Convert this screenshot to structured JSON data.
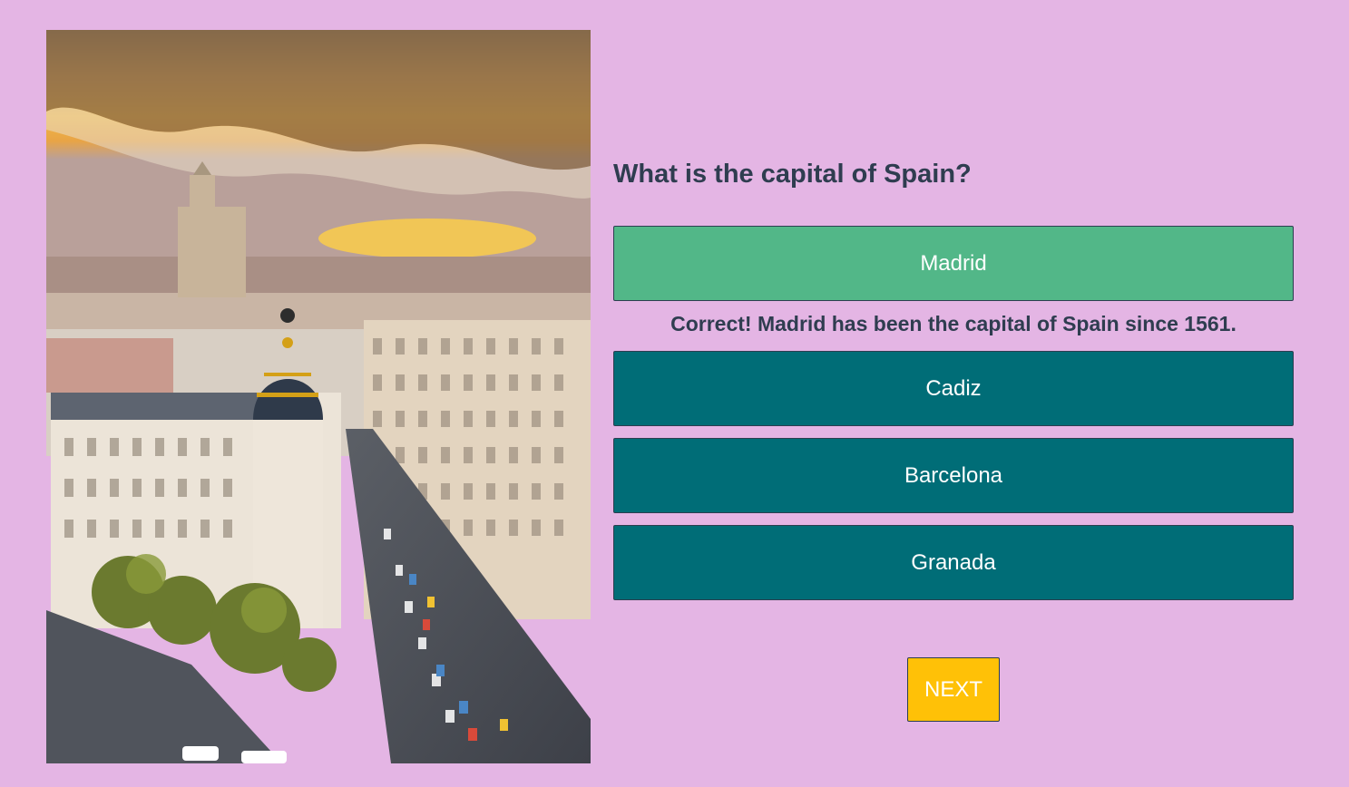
{
  "quiz": {
    "question": "What is the capital of Spain?",
    "answers": [
      {
        "label": "Madrid",
        "state": "correct"
      },
      {
        "label": "Cadiz",
        "state": "default"
      },
      {
        "label": "Barcelona",
        "state": "default"
      },
      {
        "label": "Granada",
        "state": "default"
      }
    ],
    "feedback": "Correct! Madrid has been the capital of Spain since 1561.",
    "next_label": "NEXT"
  },
  "colors": {
    "background": "#e4b5e4",
    "correct": "#52b788",
    "answer": "#006d77",
    "next": "#ffc107",
    "text": "#2f3d50"
  }
}
